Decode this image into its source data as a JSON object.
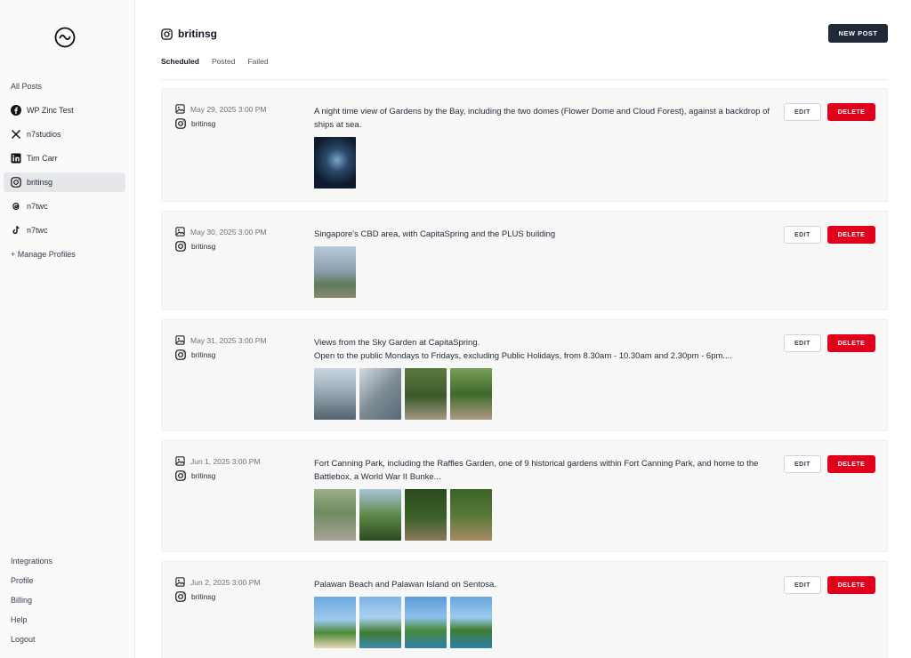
{
  "sidebar": {
    "all_posts": "All Posts",
    "profiles": [
      {
        "label": "WP Zinc Test",
        "icon": "facebook-icon"
      },
      {
        "label": "n7studios",
        "icon": "x-icon"
      },
      {
        "label": "Tim Carr",
        "icon": "linkedin-icon"
      },
      {
        "label": "britinsg",
        "icon": "instagram-icon",
        "active": true
      },
      {
        "label": "n7twc",
        "icon": "threads-icon"
      },
      {
        "label": "n7twc",
        "icon": "tiktok-icon"
      }
    ],
    "manage_profiles": "+ Manage Profiles",
    "bottom": [
      "Integrations",
      "Profile",
      "Billing",
      "Help",
      "Logout"
    ]
  },
  "header": {
    "profile_name": "britinsg",
    "new_post_label": "NEW POST"
  },
  "tabs": [
    {
      "label": "Scheduled",
      "active": true
    },
    {
      "label": "Posted"
    },
    {
      "label": "Failed"
    }
  ],
  "buttons": {
    "edit": "EDIT",
    "delete": "DELETE"
  },
  "posts": [
    {
      "date": "May 29, 2025 3:00 PM",
      "profile": "britinsg",
      "caption": "A night time view of Gardens by the Bay, including the two domes (Flower Dome and Cloud Forest), against a backdrop of ships at sea.",
      "images": [
        "t-night"
      ]
    },
    {
      "date": "May 30, 2025 3:00 PM",
      "profile": "britinsg",
      "caption": "Singapore's CBD area, with CapitaSpring and the PLUS building",
      "images": [
        "t-cbd"
      ]
    },
    {
      "date": "May 31, 2025 3:00 PM",
      "profile": "britinsg",
      "caption": "Views from the Sky Garden at CapitaSpring.\nOpen to the public Mondays to Fridays, excluding Public Holidays, from 8.30am - 10.30am and 2.30pm - 6pm....",
      "images": [
        "t-sky1",
        "t-sky2",
        "t-sky3",
        "t-sky4"
      ]
    },
    {
      "date": "Jun 1, 2025 3:00 PM",
      "profile": "britinsg",
      "caption": "Fort Canning Park, including the Raffles Garden, one of 9 historical gardens within Fort Canning Park, and home to the Battlebox, a World War II Bunke...",
      "images": [
        "t-fc1",
        "t-fc2",
        "t-fc3",
        "t-fc4"
      ]
    },
    {
      "date": "Jun 2, 2025 3:00 PM",
      "profile": "britinsg",
      "caption": "Palawan Beach and Palawan Island on Sentosa.",
      "images": [
        "t-pb1",
        "t-pb2",
        "t-pb3",
        "t-pb4"
      ]
    }
  ]
}
